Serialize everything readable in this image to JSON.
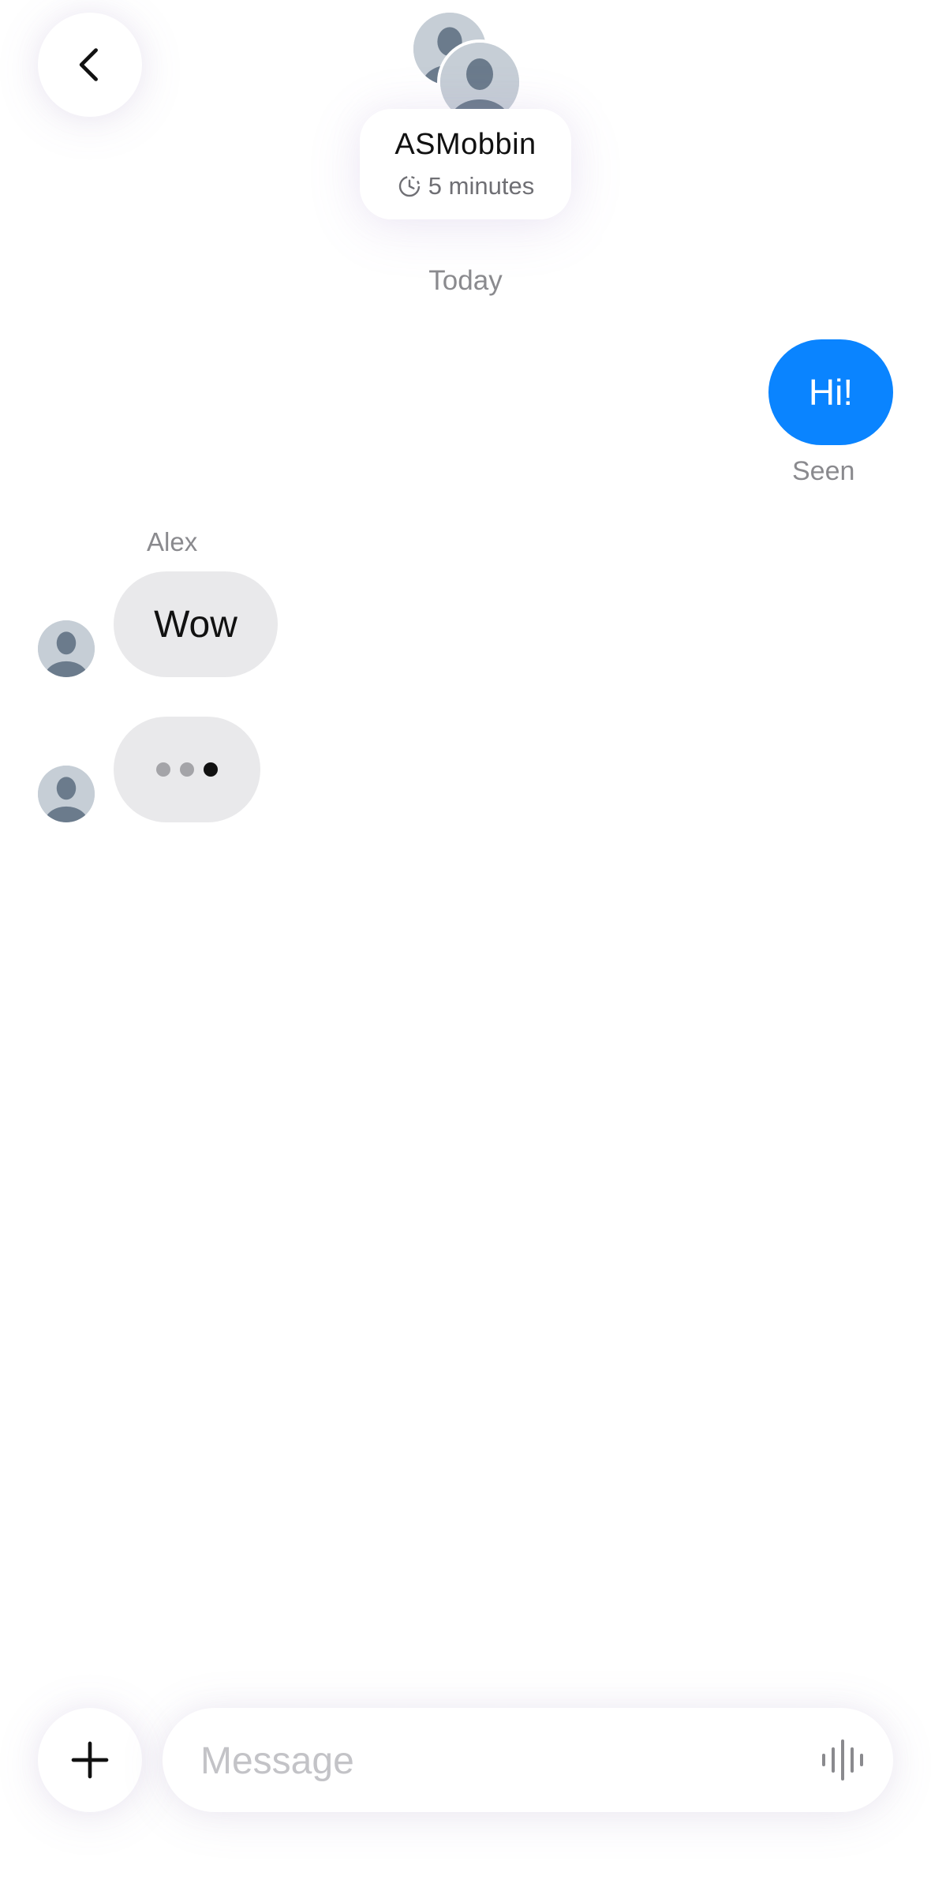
{
  "header": {
    "title": "ASMobbin",
    "timer": "5 minutes"
  },
  "conversation": {
    "date_separator": "Today",
    "outgoing": {
      "text": "Hi!",
      "status": "Seen"
    },
    "incoming": {
      "sender": "Alex",
      "text": "Wow"
    }
  },
  "composer": {
    "placeholder": "Message"
  },
  "colors": {
    "accent": "#0a84ff",
    "incoming_bubble": "#e9e9eb",
    "muted_text": "#8a8a8e"
  },
  "icons": {
    "back": "chevron-left-icon",
    "timer": "timer-icon",
    "add": "plus-icon",
    "voice": "waveform-icon",
    "avatar": "person-icon"
  }
}
